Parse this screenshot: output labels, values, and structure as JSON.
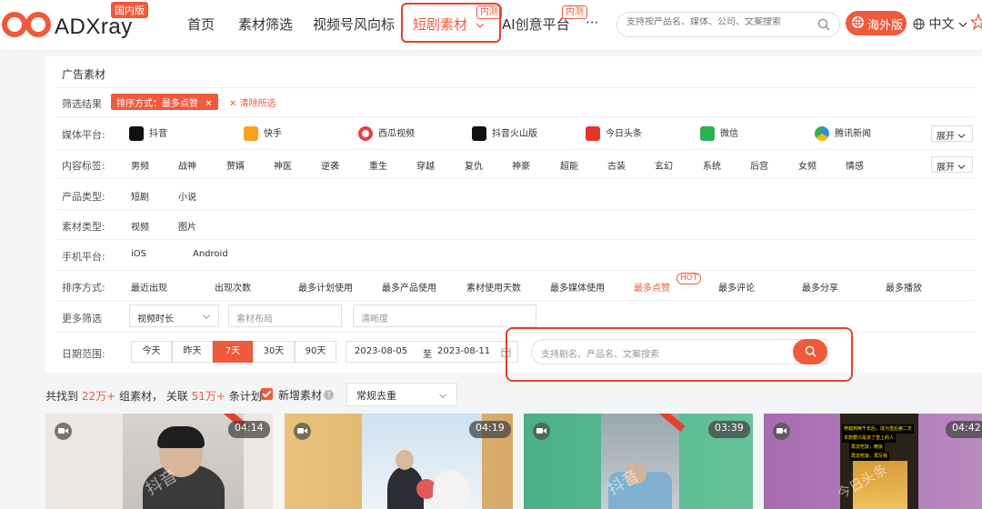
{
  "header": {
    "logo_text": "ADXray",
    "logo_badge": "国内版",
    "nav": [
      "首页",
      "素材筛选",
      "视频号风向标",
      "短剧素材",
      "AI创意平台",
      "···"
    ],
    "nav_tag_internal": "内测",
    "search_placeholder": "支持按产品名、媒体、公司、文案搜索",
    "overseas_label": "海外版",
    "language": "中文"
  },
  "panel": {
    "title": "广告素材",
    "filter_result_label": "筛选结果",
    "active_chip": "排序方式：最多点赞",
    "clear_label": "清除所选",
    "media": {
      "label": "媒体平台:",
      "items": [
        "抖音",
        "快手",
        "西瓜视频",
        "抖音火山版",
        "今日头条",
        "微信",
        "腾讯新闻"
      ],
      "expand": "展开"
    },
    "tags": {
      "label": "内容标签:",
      "items": [
        "男频",
        "战神",
        "赘婿",
        "神医",
        "逆袭",
        "重生",
        "穿越",
        "复仇",
        "神豪",
        "超能",
        "古装",
        "玄幻",
        "系统",
        "后宫",
        "女频",
        "情感"
      ],
      "expand": "展开"
    },
    "product_type": {
      "label": "产品类型:",
      "items": [
        "短剧",
        "小说"
      ]
    },
    "material_type": {
      "label": "素材类型:",
      "items": [
        "视频",
        "图片"
      ]
    },
    "phone": {
      "label": "手机平台:",
      "items": [
        "iOS",
        "Android"
      ]
    },
    "sort": {
      "label": "排序方式:",
      "items": [
        "最近出现",
        "出现次数",
        "最多计划使用",
        "最多产品使用",
        "素材使用天数",
        "最多媒体使用",
        "最多点赞",
        "最多评论",
        "最多分享",
        "最多播放"
      ],
      "hot": "HOT"
    },
    "more": {
      "label": "更多筛选",
      "duration": "视频时长",
      "layout": "素材布局",
      "clarity": "清晰度"
    },
    "date": {
      "label": "日期范围:",
      "buttons": [
        "今天",
        "昨天",
        "7天",
        "30天",
        "90天"
      ],
      "start": "2023-08-05",
      "to": "至",
      "end": "2023-08-11",
      "kw_placeholder": "支持剧名、产品名、文案搜索"
    }
  },
  "results": {
    "prefix": "共找到",
    "groups": "22万+",
    "mid": "组素材，  关联",
    "plans": "51万+",
    "suffix": "条计划",
    "new_label": "新增素材",
    "dedup": "常规去重"
  },
  "cards": [
    {
      "duration": "04:14",
      "watermark": "抖音"
    },
    {
      "duration": "04:19",
      "watermark": ""
    },
    {
      "duration": "03:39",
      "watermark": "抖音"
    },
    {
      "duration": "04:42",
      "watermark": "今日头条",
      "caption_1": "穿越到两千年后，成为皇后第二天",
      "caption_2": "本想要只是去了皇上的人",
      "caption_3": "再去吃饭，晚饭",
      "caption_4": "再去吃饭，再写我"
    }
  ],
  "colors": {
    "accent": "#ef5a3c",
    "highlight_box": "#e3432c"
  }
}
